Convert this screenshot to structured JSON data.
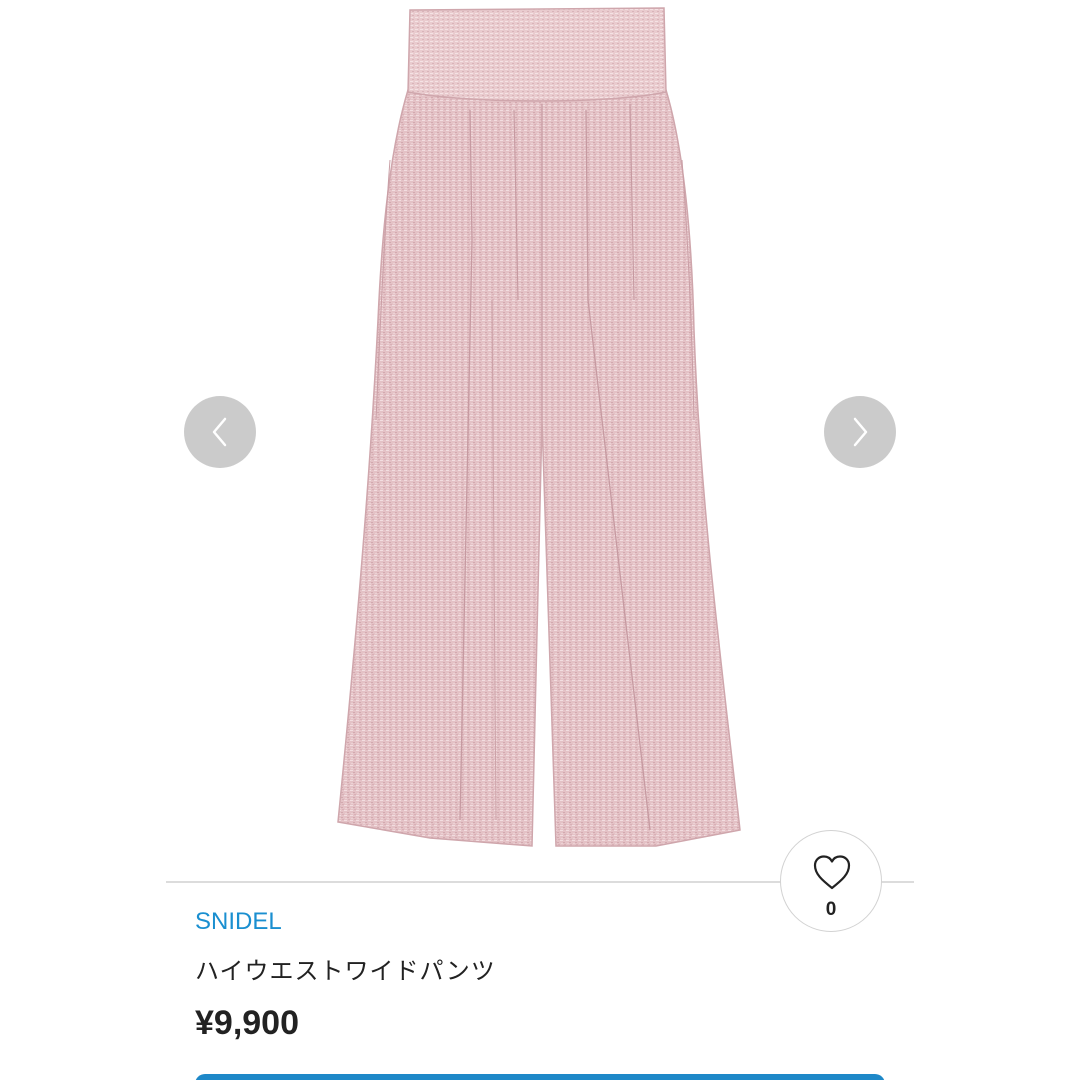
{
  "product": {
    "brand": "SNIDEL",
    "title": "ハイウエストワイドパンツ",
    "price": "¥9,900",
    "image_color": "#e6c3c6"
  },
  "like": {
    "count": "0",
    "icon": "heart-icon"
  },
  "carousel": {
    "prev_icon": "chevron-left-icon",
    "next_icon": "chevron-right-icon"
  },
  "colors": {
    "brand_link": "#1a8fd0",
    "text": "#222222",
    "divider": "#dcdcdc",
    "button": "#1e88c8"
  }
}
